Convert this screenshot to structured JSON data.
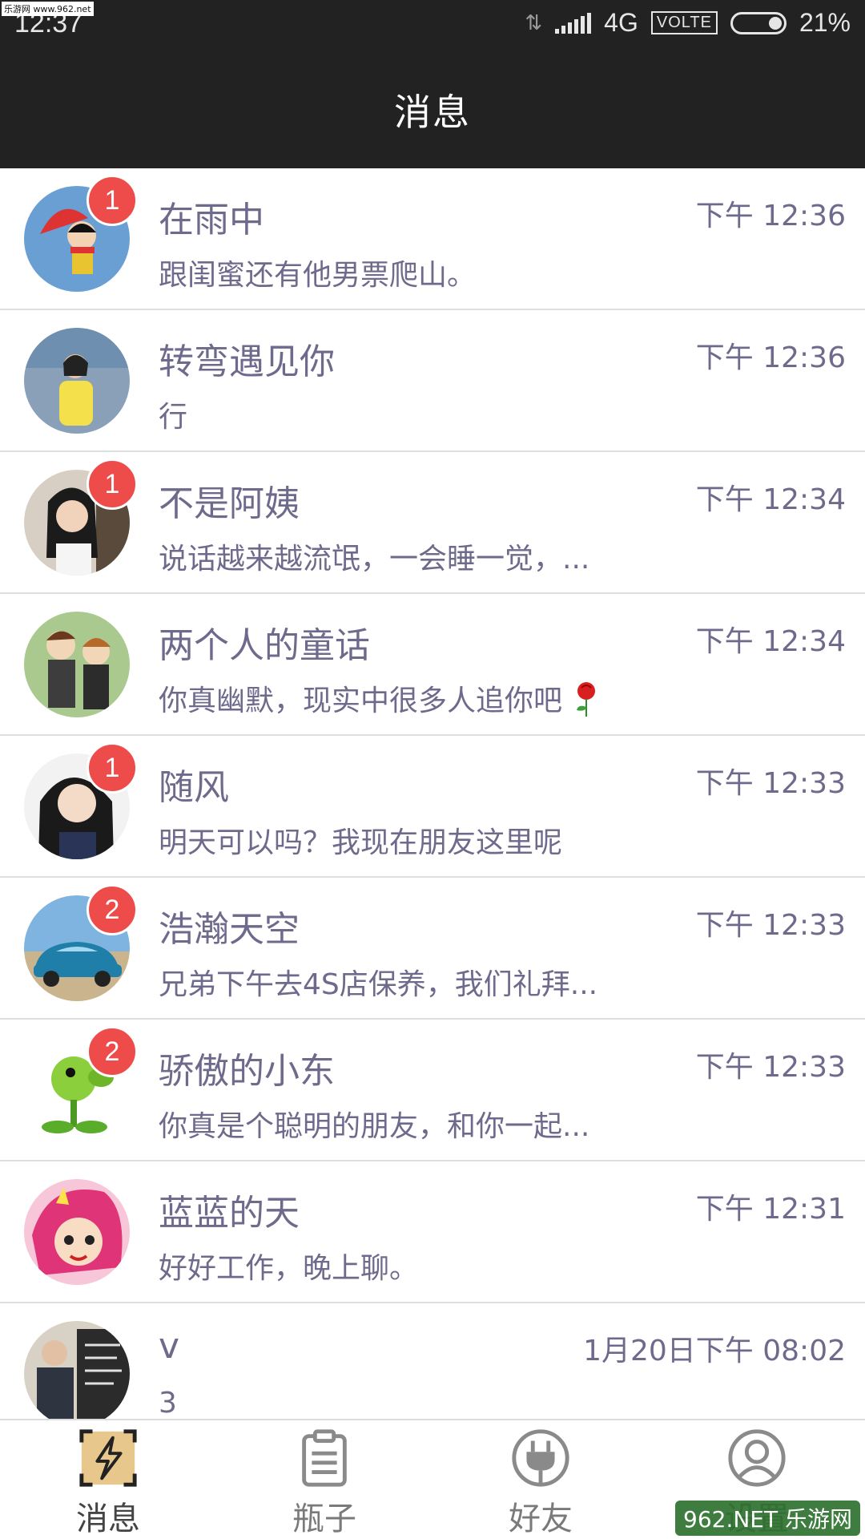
{
  "watermark": {
    "top": "乐游网 www.962.net",
    "bottom": "962.NET 乐游网"
  },
  "status_bar": {
    "time": "12:37",
    "network": "4G",
    "volte": "VOLTE",
    "battery": "21%"
  },
  "header": {
    "title": "消息"
  },
  "conversations": [
    {
      "name": "在雨中",
      "time": "下午 12:36",
      "preview": "跟闺蜜还有他男票爬山。",
      "badge": "1",
      "avatar": "cartoon-girl-umbrella"
    },
    {
      "name": "转弯遇见你",
      "time": "下午 12:36",
      "preview": "行",
      "badge": "",
      "avatar": "woman-yellow-dress"
    },
    {
      "name": "不是阿姨",
      "time": "下午 12:34",
      "preview": "说话越来越流氓，一会睡一觉，...",
      "badge": "1",
      "avatar": "woman-dark-hair"
    },
    {
      "name": "两个人的童话",
      "time": "下午 12:34",
      "preview": "你真幽默，现实中很多人追你吧",
      "badge": "",
      "avatar": "cartoon-couple",
      "emoji": "rose-icon"
    },
    {
      "name": "随风",
      "time": "下午 12:33",
      "preview": "明天可以吗？我现在朋友这里呢",
      "badge": "1",
      "avatar": "woman-portrait"
    },
    {
      "name": "浩瀚天空",
      "time": "下午 12:33",
      "preview": "兄弟下午去4S店保养，我们礼拜...",
      "badge": "2",
      "avatar": "blue-beetle-car"
    },
    {
      "name": "骄傲的小东",
      "time": "下午 12:33",
      "preview": "你真是个聪明的朋友，和你一起...",
      "badge": "2",
      "avatar": "peashooter-plant"
    },
    {
      "name": "蓝蓝的天",
      "time": "下午 12:31",
      "preview": "好好工作，晚上聊。",
      "badge": "",
      "avatar": "cartoon-pink-hair-girl"
    },
    {
      "name": "v",
      "time": "1月20日下午 08:02",
      "preview": "3",
      "badge": "",
      "avatar": "man-blackboard"
    }
  ],
  "tabs": [
    {
      "label": "消息",
      "icon": "lightning-icon",
      "active": true
    },
    {
      "label": "瓶子",
      "icon": "clipboard-icon",
      "active": false
    },
    {
      "label": "好友",
      "icon": "plug-icon",
      "active": false
    },
    {
      "label": "设置",
      "icon": "user-circle-icon",
      "active": false
    }
  ],
  "colors": {
    "bar": "#222222",
    "text": "#6e6a8c",
    "badge": "#ee4b4b",
    "tab_active_bg": "#e8c78c"
  }
}
